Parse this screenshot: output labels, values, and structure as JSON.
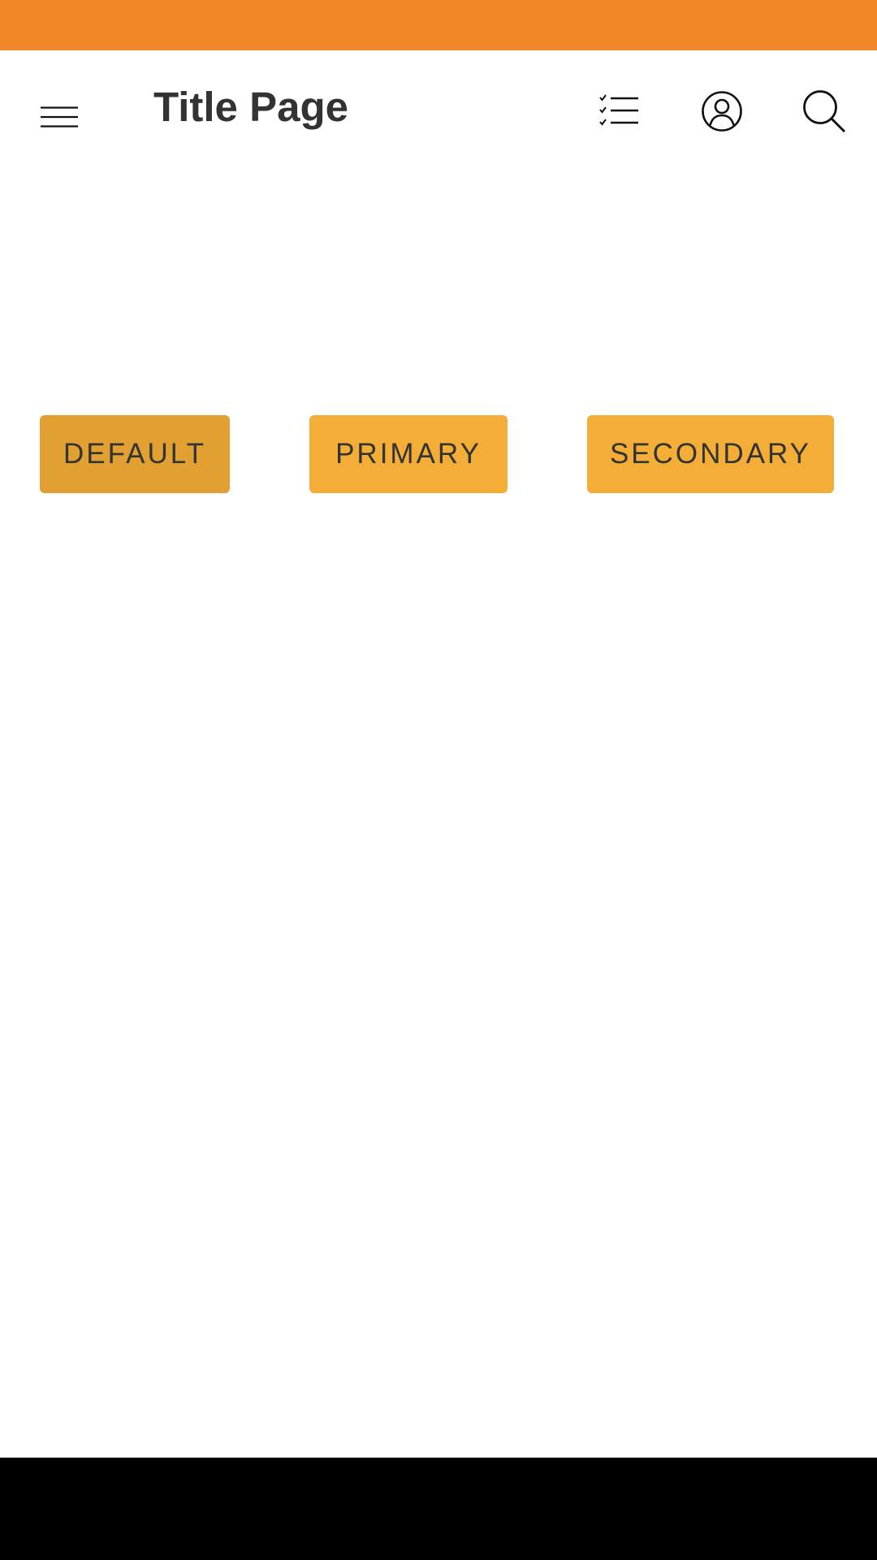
{
  "colors": {
    "status_bar": "#F08828",
    "button_default": "#E2A033",
    "button_primary": "#F4AD37",
    "button_secondary": "#F4AD37",
    "text": "#333333",
    "nav_bar": "#000000"
  },
  "app_bar": {
    "title": "Title Page",
    "icons": {
      "menu": "hamburger-menu-icon",
      "checklist": "checklist-icon",
      "account": "account-circle-icon",
      "search": "search-icon"
    }
  },
  "buttons": {
    "default_label": "DEFAULT",
    "primary_label": "PRIMARY",
    "secondary_label": "SECONDARY"
  }
}
